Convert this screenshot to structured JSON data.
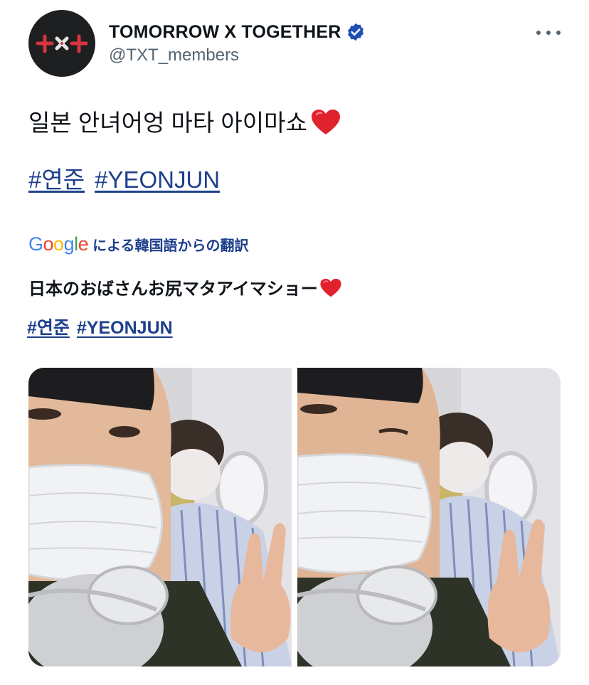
{
  "header": {
    "display_name": "TOMORROW X TOGETHER",
    "handle": "@TXT_members",
    "avatar_logo": "t×t",
    "verified": true,
    "more_icon": "more-horizontal-icon"
  },
  "tweet": {
    "text": "일본 안녀어엉 마타 아이마쇼",
    "text_emoji": "red-heart",
    "hashtags": [
      "#연준",
      "#YEONJUN"
    ]
  },
  "translation": {
    "provider": "Google",
    "label": "による韓国語からの翻訳",
    "text": "日本のおばさんお尻マタアイマショー",
    "hashtags": [
      "#연준",
      "#YEONJUN"
    ]
  },
  "media": {
    "photos": [
      "selfie-photo-1",
      "selfie-photo-2"
    ]
  },
  "colors": {
    "link": "#1d3f8c",
    "verified_badge": "#1d4fb3",
    "secondary_text": "#536471",
    "heart": "#e0222c"
  }
}
